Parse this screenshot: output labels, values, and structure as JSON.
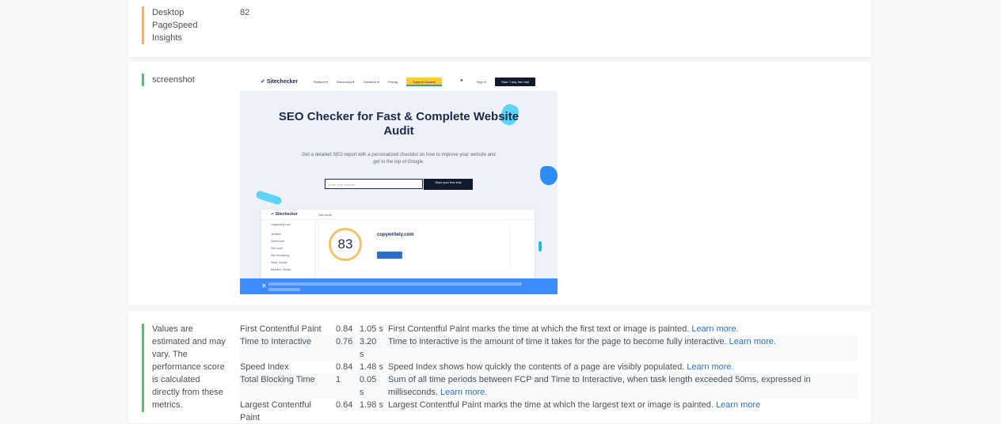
{
  "pagespeed": {
    "label_lines": [
      "Desktop",
      "PageSpeed",
      "Insights"
    ],
    "value": "82"
  },
  "screenshot_row": {
    "label": "screenshot",
    "preview": {
      "logo": "Sitechecker",
      "nav": [
        "Platform ▾",
        "Resources ▾",
        "Solutions ▾",
        "Pricing"
      ],
      "nav_pill": "Support Ukraine",
      "sign_in": "Sign in",
      "cta": "Start 7-day free trial",
      "hero_title": "SEO Checker for Fast & Complete Website Audit",
      "hero_subtitle": "Get a detailed SEO report with a personalized checklist on how to improve your website and get to the top of Google.",
      "input_placeholder": "Enter your domain",
      "hero_button": "Start your free trial",
      "dash_logo": "Sitechecker",
      "dash_tab": "Site audit",
      "score": "83",
      "dash_site": "copywritely.com",
      "side_items": [
        "copywritely.com",
        "Updates",
        "Dashboard",
        "Site audit",
        "Site Monitoring",
        "Rank Tracker",
        "Backlink Tracker"
      ]
    }
  },
  "metrics_row": {
    "label_lines": [
      "Values are",
      "estimated and may",
      "vary. The",
      "performance score",
      "is calculated",
      "directly from these",
      "metrics."
    ],
    "rows": [
      {
        "name": [
          "First Contentful Paint"
        ],
        "score": "0.84",
        "value": [
          "1.05 s"
        ],
        "desc": [
          "First Contentful Paint marks the time at which the first text or image is painted. "
        ],
        "link": "Learn more."
      },
      {
        "name": [
          "Time to Interactive"
        ],
        "score": "0.76",
        "value": [
          "3.20",
          "s"
        ],
        "desc": [
          "Time to interactive is the amount of time it takes for the page to become fully interactive. "
        ],
        "link": "Learn more."
      },
      {
        "name": [
          "Speed Index"
        ],
        "score": "0.84",
        "value": [
          "1.48 s"
        ],
        "desc": [
          "Speed Index shows how quickly the contents of a page are visibly populated. "
        ],
        "link": "Learn more."
      },
      {
        "name": [
          "Total Blocking Time"
        ],
        "score": "1",
        "value": [
          "0.05",
          "s"
        ],
        "desc": [
          "Sum of all time periods between FCP and Time to Interactive, when task length exceeded 50ms, expressed in",
          "milliseconds. "
        ],
        "link": "Learn more."
      },
      {
        "name": [
          "Largest Contentful",
          "Paint"
        ],
        "score": "0.64",
        "value": [
          "1.98 s"
        ],
        "desc": [
          "Largest Contentful Paint marks the time at which the largest text or image is painted. "
        ],
        "link": "Learn more"
      }
    ]
  },
  "colors": {
    "bar_pagespeed": "#f5b840",
    "bar_green": "#4cc36b",
    "link": "#2e6fcc"
  }
}
